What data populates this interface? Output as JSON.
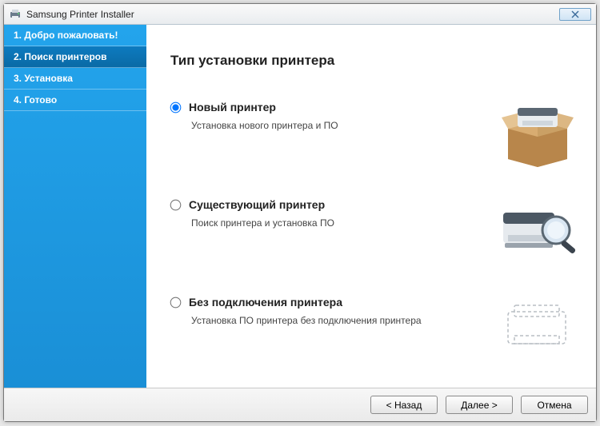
{
  "window": {
    "title": "Samsung Printer Installer"
  },
  "sidebar": {
    "steps": [
      {
        "label": "1. Добро пожаловать!"
      },
      {
        "label": "2. Поиск принтеров"
      },
      {
        "label": "3. Установка"
      },
      {
        "label": "4. Готово"
      }
    ],
    "currentIndex": 1
  },
  "content": {
    "title": "Тип установки принтера",
    "options": [
      {
        "label": "Новый принтер",
        "desc": "Установка нового принтера и ПО",
        "selected": true,
        "icon": "printer-in-box"
      },
      {
        "label": "Существующий принтер",
        "desc": "Поиск принтера и установка ПО",
        "selected": false,
        "icon": "printer-search"
      },
      {
        "label": "Без подключения принтера",
        "desc": "Установка ПО принтера без подключения принтера",
        "selected": false,
        "icon": "printer-ghost"
      }
    ]
  },
  "footer": {
    "back": "< Назад",
    "next": "Далее >",
    "cancel": "Отмена"
  }
}
